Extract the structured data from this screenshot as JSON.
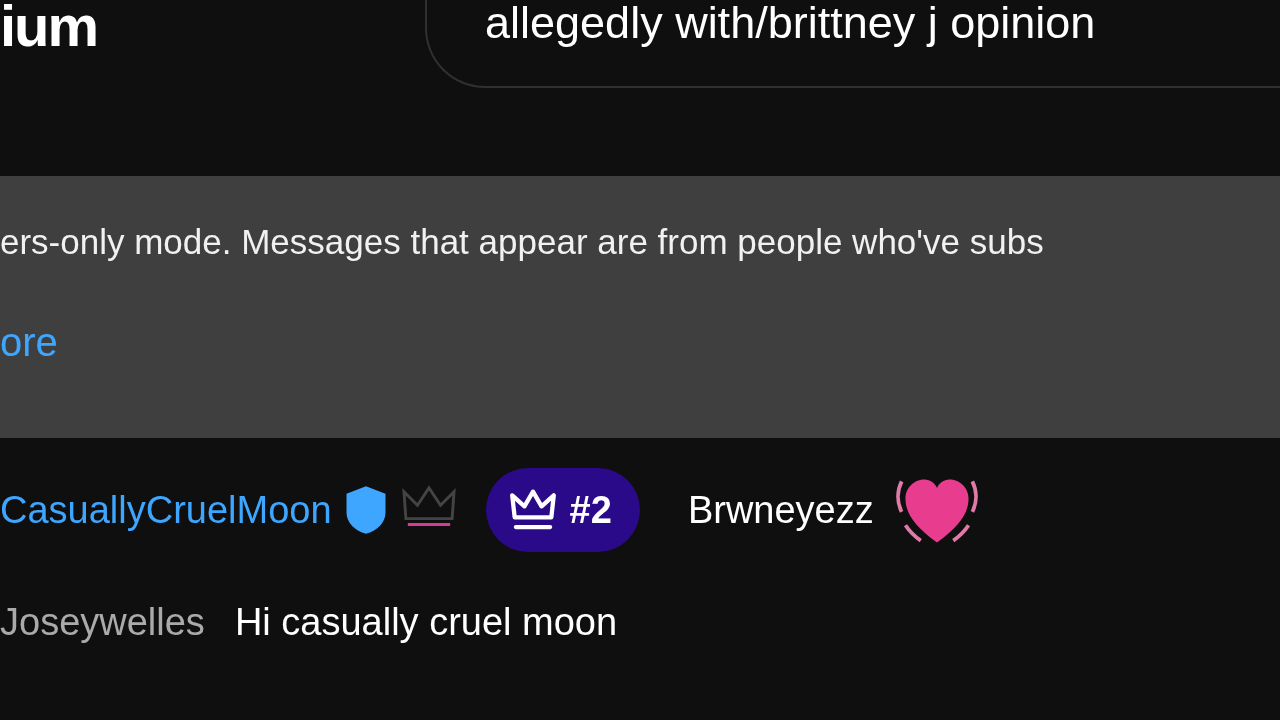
{
  "header": {
    "brand_fragment": "ium",
    "stream_title": "allegedly with/brittney j opinion"
  },
  "notice": {
    "text": "ers-only mode. Messages that appear are from people who've subs",
    "link": "ore"
  },
  "messages": [
    {
      "author": "CasuallyCruelMoon",
      "color": "#3ea6ff",
      "moderator": true,
      "member_badge": true,
      "rank": "#2",
      "message": "Brwneyezz",
      "heart_emoji": true
    },
    {
      "author": "Joseywelles",
      "color": "#aaaaaa",
      "moderator": false,
      "member_badge": false,
      "message": "Hi casually cruel moon",
      "heart_emoji": false
    }
  ]
}
